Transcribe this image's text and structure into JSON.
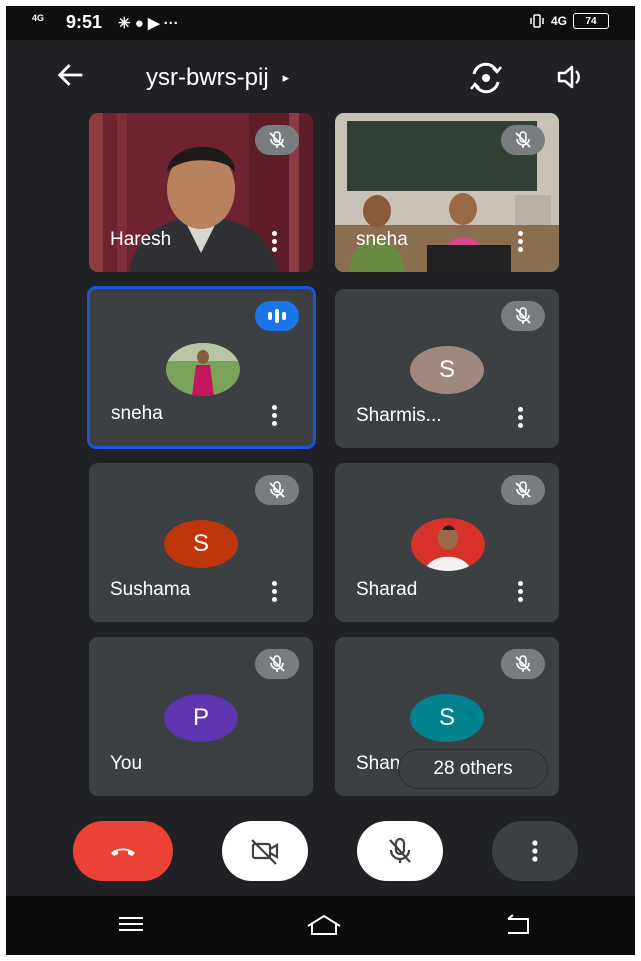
{
  "status_bar": {
    "network": "4G",
    "time": "9:51",
    "app_icons": "✳ ● ▶ ···",
    "right_network": "4G",
    "battery": "74"
  },
  "header": {
    "meeting_code": "ysr-bwrs-pij",
    "caret": "▸"
  },
  "participants": [
    {
      "name": "Haresh",
      "type": "video"
    },
    {
      "name": "sneha",
      "type": "video"
    },
    {
      "name": "sneha",
      "type": "photo",
      "speaking": true
    },
    {
      "name": "Sharmis...",
      "initial": "S",
      "avatar_color": "#a1887f"
    },
    {
      "name": "Sushama",
      "initial": "S",
      "avatar_color": "#bf360c"
    },
    {
      "name": "Sharad",
      "type": "photo"
    },
    {
      "name": "You",
      "initial": "P",
      "avatar_color": "#5e35b1"
    },
    {
      "name": "Shan",
      "initial": "S",
      "avatar_color": "#00838f"
    }
  ],
  "others_label": "28 others",
  "controls": {
    "end_call_color": "#ea4335",
    "camera": "camera-off",
    "mic": "mic-off"
  }
}
